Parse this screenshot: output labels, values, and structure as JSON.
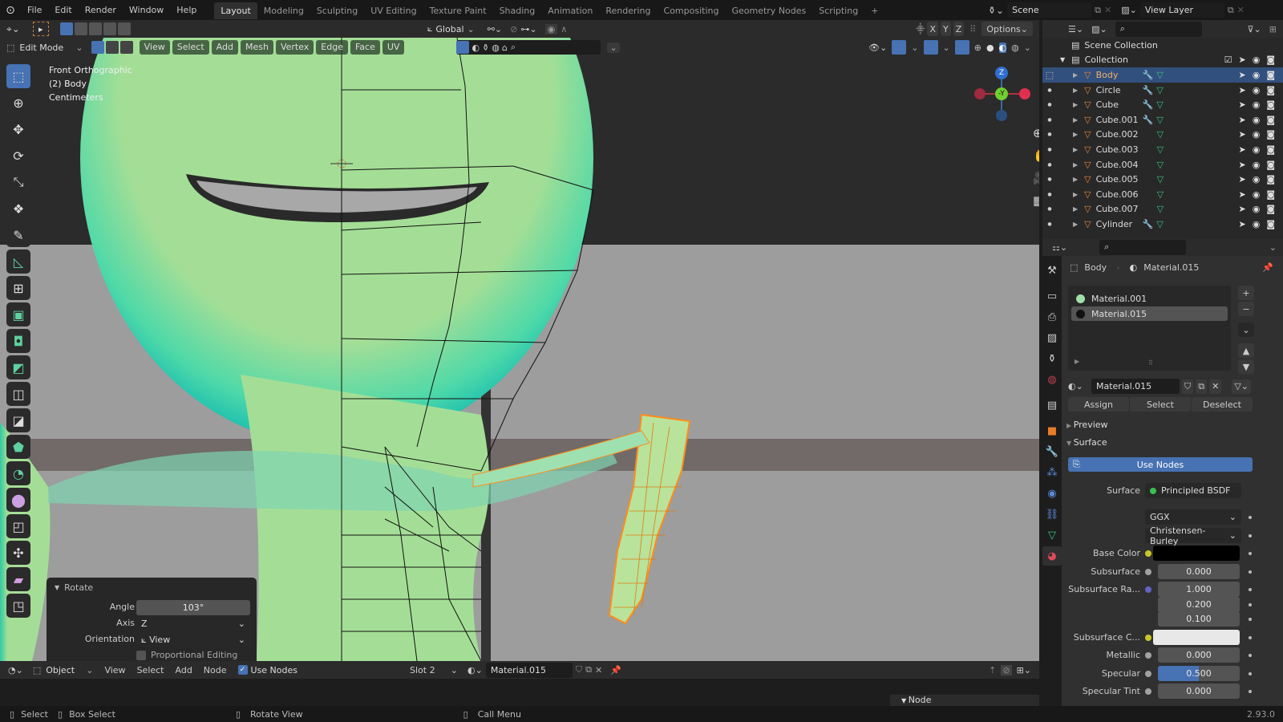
{
  "topbar": {
    "menus": [
      "File",
      "Edit",
      "Render",
      "Window",
      "Help"
    ],
    "workspaces": [
      "Layout",
      "Modeling",
      "Sculpting",
      "UV Editing",
      "Texture Paint",
      "Shading",
      "Animation",
      "Rendering",
      "Compositing",
      "Geometry Nodes",
      "Scripting"
    ],
    "active_workspace": "Layout",
    "add_tab": "+",
    "scene": "Scene",
    "view_layer": "View Layer"
  },
  "viewport": {
    "mode": "Edit Mode",
    "menus": [
      "View",
      "Select",
      "Add",
      "Mesh",
      "Vertex",
      "Edge",
      "Face",
      "UV"
    ],
    "orientation": "Global",
    "axes": [
      "X",
      "Y",
      "Z"
    ],
    "options": "Options",
    "info": [
      "Front Orthographic",
      "(2) Body",
      "Centimeters"
    ],
    "gizmo": {
      "z": "Z",
      "y": "-Y"
    },
    "accent_color": "#4772b3"
  },
  "operator_panel": {
    "title": "Rotate",
    "angle_label": "Angle",
    "angle_value": "103°",
    "axis_label": "Axis",
    "axis_value": "Z",
    "orientation_label": "Orientation",
    "orientation_value": "View",
    "proportional_label": "Proportional Editing",
    "proportional_checked": false
  },
  "outliner": {
    "root": "Scene Collection",
    "collection": "Collection",
    "items": [
      {
        "name": "Body",
        "selected": true,
        "modifier": true
      },
      {
        "name": "Circle",
        "selected": false,
        "modifier": true
      },
      {
        "name": "Cube",
        "selected": false,
        "modifier": true
      },
      {
        "name": "Cube.001",
        "selected": false,
        "modifier": true
      },
      {
        "name": "Cube.002",
        "selected": false,
        "modifier": false
      },
      {
        "name": "Cube.003",
        "selected": false,
        "modifier": false
      },
      {
        "name": "Cube.004",
        "selected": false,
        "modifier": false
      },
      {
        "name": "Cube.005",
        "selected": false,
        "modifier": false
      },
      {
        "name": "Cube.006",
        "selected": false,
        "modifier": false
      },
      {
        "name": "Cube.007",
        "selected": false,
        "modifier": false
      },
      {
        "name": "Cylinder",
        "selected": false,
        "modifier": true
      }
    ]
  },
  "properties": {
    "breadcrumb_object": "Body",
    "breadcrumb_material": "Material.015",
    "slots": [
      {
        "name": "Material.001",
        "color": "#9fe0a8",
        "active": false
      },
      {
        "name": "Material.015",
        "color": "#111111",
        "active": true
      }
    ],
    "material_name": "Material.015",
    "assign": "Assign",
    "select": "Select",
    "deselect": "Deselect",
    "preview_panel": "Preview",
    "surface_panel": "Surface",
    "use_nodes": "Use Nodes",
    "surface_label": "Surface",
    "surface_value": "Principled BSDF",
    "distribution": "GGX",
    "subsurface_method": "Christensen-Burley",
    "fields": [
      {
        "label": "Base Color",
        "socket": "#c7c729",
        "type": "color",
        "color": "#000000"
      },
      {
        "label": "Subsurface",
        "socket": "#a1a1a1",
        "type": "number",
        "values": [
          "0.000"
        ]
      },
      {
        "label": "Subsurface Ra...",
        "socket": "#6363c7",
        "type": "vector",
        "values": [
          "1.000",
          "0.200",
          "0.100"
        ]
      },
      {
        "label": "Subsurface C...",
        "socket": "#c7c729",
        "type": "color",
        "color": "#e8e8e8"
      },
      {
        "label": "Metallic",
        "socket": "#a1a1a1",
        "type": "number",
        "values": [
          "0.000"
        ]
      },
      {
        "label": "Specular",
        "socket": "#a1a1a1",
        "type": "slider",
        "values": [
          "0.500"
        ],
        "fill": 0.5
      },
      {
        "label": "Specular Tint",
        "socket": "#a1a1a1",
        "type": "number",
        "values": [
          "0.000"
        ]
      }
    ]
  },
  "shader_header": {
    "editor_mode": "Object",
    "menus": [
      "View",
      "Select",
      "Add",
      "Node"
    ],
    "use_nodes_label": "Use Nodes",
    "use_nodes_checked": true,
    "slot": "Slot 2",
    "material": "Material.015",
    "node_panel": "Node"
  },
  "statusbar": {
    "select": "Select",
    "box_select": "Box Select",
    "rotate_view": "Rotate View",
    "call_menu": "Call Menu",
    "version": "2.93.0"
  }
}
